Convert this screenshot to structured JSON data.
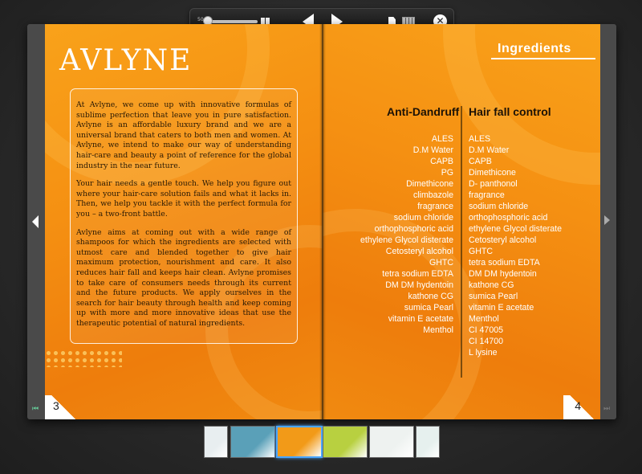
{
  "toolbar": {
    "zoom_label": "50",
    "close_glyph": "✕",
    "icons": [
      "zoom-slider-icon",
      "two-page-view-icon",
      "previous-page-arrow-icon",
      "next-page-arrow-icon",
      "single-page-icon",
      "thumbnails-icon",
      "close-icon"
    ]
  },
  "left_page": {
    "logo": "AVLYNE",
    "paragraphs": [
      "At Avlyne, we come up with innovative formulas of sublime perfection that leave you in pure satisfaction. Avlyne is an affordable luxury brand and we are a universal brand that caters to both men and women. At Avlyne, we intend to make our way of understanding hair-care and beauty a point of reference for the global industry in the near future.",
      "Your hair needs a gentle touch. We help you figure out where your hair-care solution fails and what it lacks in. Then, we help you tackle it with the perfect formula for you – a two-front battle.",
      "Avlyne aims at coming out with a wide range of shampoos for which the ingredients are selected with utmost care and blended together to give hair maximum protection, nourishment and care. It also reduces hair fall and keeps hair clean. Avlyne promises to take care of consumers needs through its current and the future products. We apply ourselves in the search for hair beauty through health and keep coming up with more and more innovative ideas that use the therapeutic potential of natural ingredients."
    ],
    "page_number": "3"
  },
  "right_page": {
    "header": "Ingredients",
    "anti_dandruff": {
      "title": "Anti-Dandruff",
      "items": [
        "ALES",
        "D.M Water",
        "CAPB",
        "PG",
        "Dimethicone",
        "climbazole",
        "fragrance",
        "sodium chloride",
        "orthophosphoric acid",
        "ethylene Glycol disterate",
        "Cetosteryl alcohol",
        "GHTC",
        "tetra sodium EDTA",
        "DM DM hydentoin",
        "kathone CG",
        "sumica Pearl",
        "vitamin E acetate",
        "Menthol"
      ]
    },
    "hair_fall": {
      "title": "Hair fall control",
      "items": [
        "ALES",
        "D.M Water",
        "CAPB",
        "Dimethicone",
        "D- panthonol",
        "fragrance",
        "sodium chloride",
        "orthophosphoric acid",
        "ethylene Glycol disterate",
        "Cetosteryl alcohol",
        "GHTC",
        "tetra sodium EDTA",
        "DM DM hydentoin",
        "kathone CG",
        "sumica Pearl",
        "vitamin E acetate",
        "Menthol",
        "CI 47005",
        "CI 14700",
        "L lysine"
      ]
    },
    "page_number": "4"
  },
  "thumbnails": {
    "count": 6,
    "active_index": 2,
    "colors": [
      "#e8eef0",
      "#5aa0b8",
      "#f29a18",
      "#b8d040",
      "#eef2f0",
      "#e6f0ee"
    ]
  }
}
